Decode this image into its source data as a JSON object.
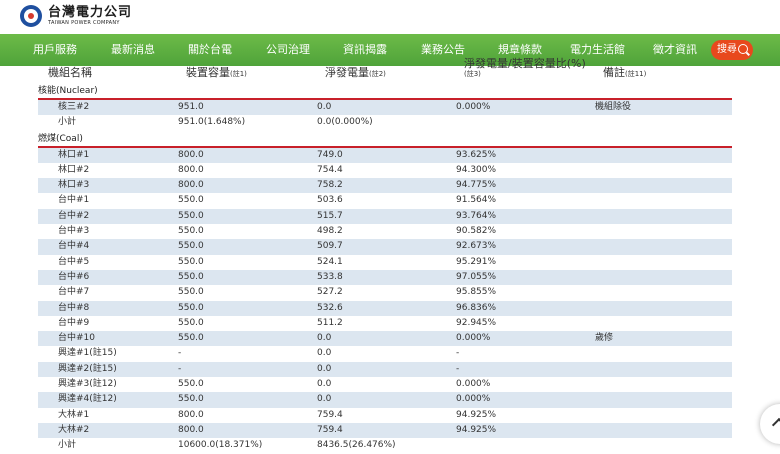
{
  "header": {
    "logo_zh": "台灣電力公司",
    "logo_en": "TAIWAN POWER COMPANY"
  },
  "nav": {
    "items": [
      "用戶服務",
      "最新消息",
      "關於台電",
      "公司治理",
      "資訊揭露",
      "業務公告",
      "規章條款",
      "電力生活館",
      "徵才資訊"
    ],
    "search_label": "搜尋"
  },
  "table": {
    "headers": {
      "name": "機組名稱",
      "capacity": "裝置容量",
      "capacity_note": "(註1)",
      "net": "淨發電量",
      "net_note": "(註2)",
      "ratio": "淨發電量/裝置容量比(%)",
      "ratio_note": "(註3)",
      "remark": "備註",
      "remark_note": "(註11)"
    },
    "sections": [
      {
        "title": "核能(Nuclear)",
        "rows": [
          {
            "name": "核三#2",
            "capacity": "951.0",
            "net": "0.0",
            "ratio": "0.000%",
            "remark": "機組除役"
          },
          {
            "name": "小計",
            "capacity": "951.0(1.648%)",
            "net": "0.0(0.000%)",
            "ratio": "",
            "remark": ""
          }
        ]
      },
      {
        "title": "燃煤(Coal)",
        "rows": [
          {
            "name": "林口#1",
            "capacity": "800.0",
            "net": "749.0",
            "ratio": "93.625%",
            "remark": ""
          },
          {
            "name": "林口#2",
            "capacity": "800.0",
            "net": "754.4",
            "ratio": "94.300%",
            "remark": ""
          },
          {
            "name": "林口#3",
            "capacity": "800.0",
            "net": "758.2",
            "ratio": "94.775%",
            "remark": ""
          },
          {
            "name": "台中#1",
            "capacity": "550.0",
            "net": "503.6",
            "ratio": "91.564%",
            "remark": ""
          },
          {
            "name": "台中#2",
            "capacity": "550.0",
            "net": "515.7",
            "ratio": "93.764%",
            "remark": ""
          },
          {
            "name": "台中#3",
            "capacity": "550.0",
            "net": "498.2",
            "ratio": "90.582%",
            "remark": ""
          },
          {
            "name": "台中#4",
            "capacity": "550.0",
            "net": "509.7",
            "ratio": "92.673%",
            "remark": ""
          },
          {
            "name": "台中#5",
            "capacity": "550.0",
            "net": "524.1",
            "ratio": "95.291%",
            "remark": ""
          },
          {
            "name": "台中#6",
            "capacity": "550.0",
            "net": "533.8",
            "ratio": "97.055%",
            "remark": ""
          },
          {
            "name": "台中#7",
            "capacity": "550.0",
            "net": "527.2",
            "ratio": "95.855%",
            "remark": ""
          },
          {
            "name": "台中#8",
            "capacity": "550.0",
            "net": "532.6",
            "ratio": "96.836%",
            "remark": ""
          },
          {
            "name": "台中#9",
            "capacity": "550.0",
            "net": "511.2",
            "ratio": "92.945%",
            "remark": ""
          },
          {
            "name": "台中#10",
            "capacity": "550.0",
            "net": "0.0",
            "ratio": "0.000%",
            "remark": "歲修"
          },
          {
            "name": "興達#1(註15)",
            "capacity": "-",
            "net": "0.0",
            "ratio": "-",
            "remark": ""
          },
          {
            "name": "興達#2(註15)",
            "capacity": "-",
            "net": "0.0",
            "ratio": "-",
            "remark": ""
          },
          {
            "name": "興達#3(註12)",
            "capacity": "550.0",
            "net": "0.0",
            "ratio": "0.000%",
            "remark": ""
          },
          {
            "name": "興達#4(註12)",
            "capacity": "550.0",
            "net": "0.0",
            "ratio": "0.000%",
            "remark": ""
          },
          {
            "name": "大林#1",
            "capacity": "800.0",
            "net": "759.4",
            "ratio": "94.925%",
            "remark": ""
          },
          {
            "name": "大林#2",
            "capacity": "800.0",
            "net": "759.4",
            "ratio": "94.925%",
            "remark": ""
          },
          {
            "name": "小計",
            "capacity": "10600.0(18.371%)",
            "net": "8436.5(26.476%)",
            "ratio": "",
            "remark": ""
          }
        ]
      }
    ]
  }
}
